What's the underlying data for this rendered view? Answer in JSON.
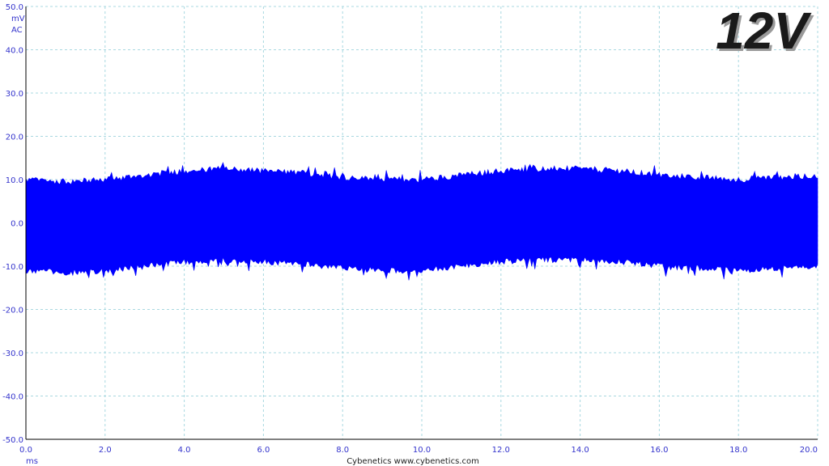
{
  "rail_label": "12V",
  "credit": "Cybenetics  www.cybenetics.com",
  "colors": {
    "trace": "#0000ff",
    "grid": "#a8d8e0",
    "tick_text": "#3333cc",
    "axis": "#000000"
  },
  "chart_data": {
    "type": "line",
    "title": "",
    "xlabel": "ms",
    "ylabel": "mV AC",
    "y_unit_lines": [
      "mV",
      "AC"
    ],
    "xlim": [
      0.0,
      20.0
    ],
    "ylim": [
      -50.0,
      50.0
    ],
    "x_ticks": [
      "0.0",
      "2.0",
      "4.0",
      "6.0",
      "8.0",
      "10.0",
      "12.0",
      "14.0",
      "16.0",
      "18.0",
      "20.0"
    ],
    "y_ticks": [
      "50.0",
      "40.0",
      "30.0",
      "20.0",
      "10.0",
      "0.0",
      "-10.0",
      "-20.0",
      "-30.0",
      "-40.0",
      "-50.0"
    ],
    "grid": true,
    "series": [
      {
        "envelope_x": [
          0.0,
          1.0,
          2.0,
          3.0,
          4.0,
          5.0,
          6.0,
          7.0,
          8.0,
          9.0,
          10.0,
          11.0,
          12.0,
          13.0,
          14.0,
          15.0,
          16.0,
          17.0,
          18.0,
          19.0,
          20.0
        ],
        "envelope_max": [
          10.0,
          9.5,
          10.0,
          11.0,
          12.0,
          12.5,
          12.0,
          11.5,
          10.5,
          10.0,
          10.0,
          11.0,
          12.0,
          12.5,
          12.5,
          12.0,
          11.0,
          10.5,
          10.0,
          10.5,
          11.0
        ],
        "envelope_min": [
          -11.0,
          -11.5,
          -11.0,
          -10.0,
          -9.0,
          -8.5,
          -9.0,
          -9.5,
          -10.5,
          -11.0,
          -11.0,
          -10.0,
          -9.0,
          -8.5,
          -8.5,
          -9.0,
          -10.0,
          -10.5,
          -11.0,
          -10.5,
          -10.0
        ]
      }
    ]
  }
}
